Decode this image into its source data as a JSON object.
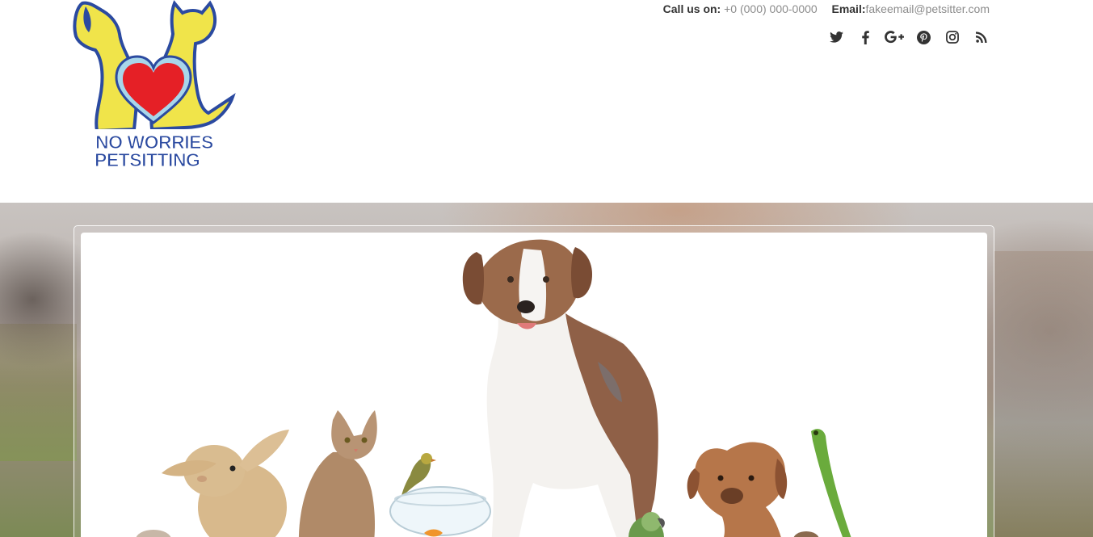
{
  "header": {
    "logo": {
      "line1": "NO WORRIES",
      "line2": "PETSITTING"
    },
    "contact": {
      "call_label": "Call us on:",
      "phone": "+0 (000) 000-0000",
      "email_label": "Email:",
      "email": "fakeemail@petsitter.com"
    },
    "social_icons": [
      "twitter-icon",
      "facebook-icon",
      "google-plus-icon",
      "pinterest-icon",
      "instagram-icon",
      "rss-icon"
    ]
  },
  "colors": {
    "logo_blue": "#2b4aa0",
    "logo_yellow": "#f0e44a",
    "logo_red": "#e52026",
    "icon_color": "#333333",
    "contact_gray": "#8c8c8c"
  },
  "hero": {
    "image": "pets-group-photo"
  }
}
